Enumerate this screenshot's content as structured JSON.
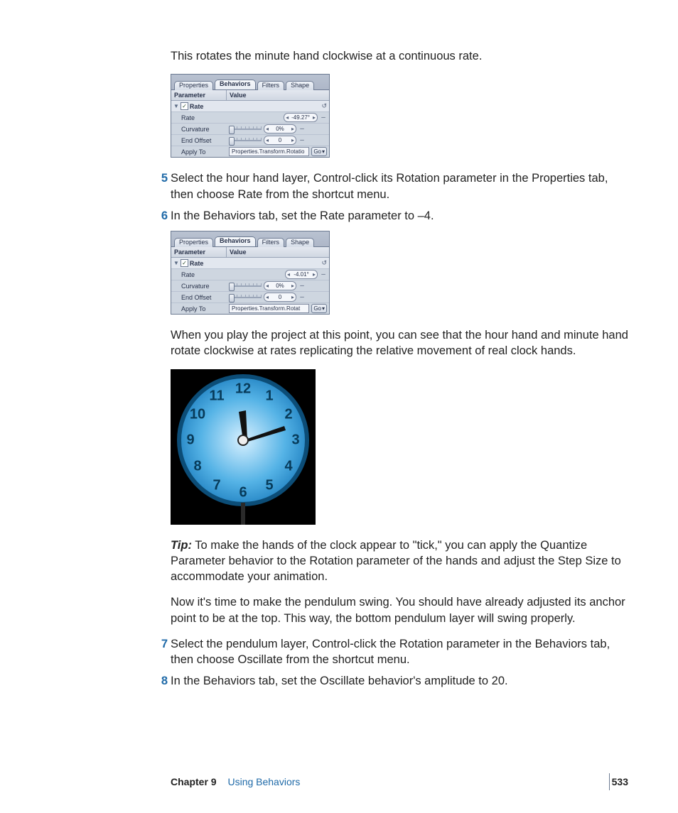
{
  "intro": "This rotates the minute hand clockwise at a continuous rate.",
  "panel1": {
    "tabs": [
      "Properties",
      "Behaviors",
      "Filters",
      "Shape"
    ],
    "activeTab": 1,
    "header_param": "Parameter",
    "header_value": "Value",
    "group_name": "Rate",
    "rows": {
      "rate_label": "Rate",
      "rate_value": "-49.27°",
      "curv_label": "Curvature",
      "curv_value": "0%",
      "endoff_label": "End Offset",
      "endoff_value": "0",
      "apply_label": "Apply To",
      "apply_value": "Properties.Transform.Rotatio",
      "go": "Go"
    }
  },
  "step5_num": "5",
  "step5": "Select the hour hand layer, Control-click its Rotation parameter in the Properties tab, then choose Rate from the shortcut menu.",
  "step6_num": "6",
  "step6": "In the Behaviors tab, set the Rate parameter to –4.",
  "panel2": {
    "tabs": [
      "Properties",
      "Behaviors",
      "Filters",
      "Shape"
    ],
    "activeTab": 1,
    "header_param": "Parameter",
    "header_value": "Value",
    "group_name": "Rate",
    "rows": {
      "rate_label": "Rate",
      "rate_value": "-4.01°",
      "curv_label": "Curvature",
      "curv_value": "0%",
      "endoff_label": "End Offset",
      "endoff_value": "0",
      "apply_label": "Apply To",
      "apply_value": "Properties.Transform.Rotat",
      "go": "Go"
    }
  },
  "after_panel2": "When you play the project at this point, you can see that the hour hand and minute hand rotate clockwise at rates replicating the relative movement of real clock hands.",
  "clock_numbers": [
    "12",
    "1",
    "2",
    "3",
    "4",
    "5",
    "6",
    "7",
    "8",
    "9",
    "10",
    "11"
  ],
  "tip_label": "Tip:",
  "tip_text": "  To make the hands of the clock appear to \"tick,\" you can apply the Quantize Parameter behavior to the Rotation parameter of the hands and adjust the Step Size to accommodate your animation.",
  "pendulum_intro": "Now it's time to make the pendulum swing. You should have already adjusted its anchor point to be at the top. This way, the bottom pendulum layer will swing properly.",
  "step7_num": "7",
  "step7": "Select the pendulum layer, Control-click the Rotation parameter in the Behaviors tab, then choose Oscillate from the shortcut menu.",
  "step8_num": "8",
  "step8": "In the Behaviors tab, set the Oscillate behavior's amplitude to 20.",
  "footer": {
    "chapter_label": "Chapter 9",
    "chapter_title": "Using Behaviors",
    "page": "533"
  }
}
